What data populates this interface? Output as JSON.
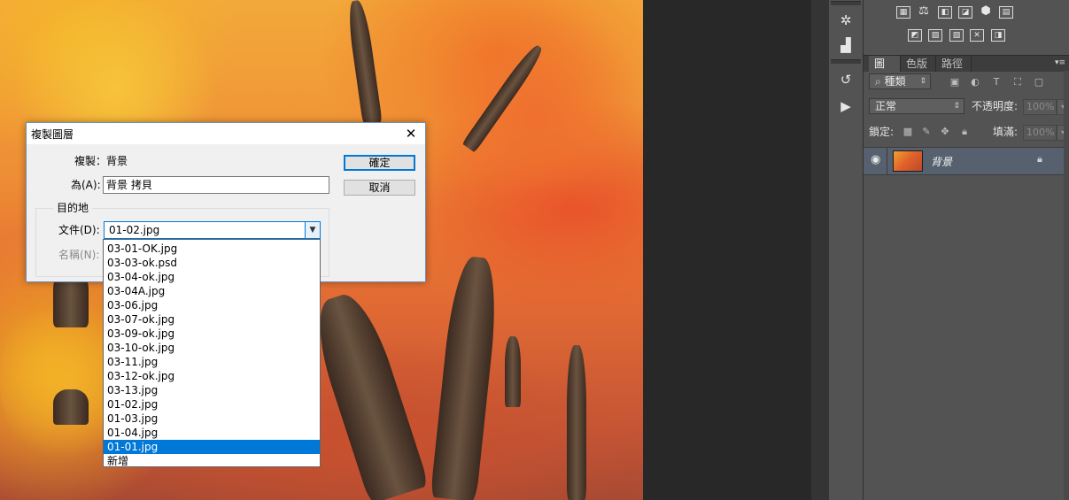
{
  "dialog": {
    "title": "複製圖層",
    "duplicate_label": "複製：",
    "duplicate_value": "背景",
    "as_label": "為(A):",
    "as_value": "背景 拷貝",
    "ok": "確定",
    "cancel": "取消",
    "destination_label": "目的地",
    "document_label": "文件(D):",
    "document_value": "01-02.jpg",
    "name_label": "名稱(N):"
  },
  "dropdown": {
    "items": [
      "03-01-OK.jpg",
      "03-03-ok.psd",
      "03-04-ok.jpg",
      "03-04A.jpg",
      "03-06.jpg",
      "03-07-ok.jpg",
      "03-09-ok.jpg",
      "03-10-ok.jpg",
      "03-11.jpg",
      "03-12-ok.jpg",
      "03-13.jpg",
      "01-02.jpg",
      "01-03.jpg",
      "01-04.jpg",
      "01-01.jpg",
      "新增"
    ],
    "selected": "01-01.jpg"
  },
  "panel": {
    "tabs": [
      "圖層",
      "色版",
      "路徑"
    ],
    "active_tab": "圖層",
    "kind_label": "種類",
    "blend_mode": "正常",
    "opacity_label": "不透明度:",
    "opacity_value": "100%",
    "lock_label": "鎖定:",
    "fill_label": "填滿:",
    "fill_value": "100%",
    "layer_name": "背景"
  },
  "colors": {
    "selection": "#0078d7",
    "panel_bg": "#535353",
    "layer_selected": "#56606e"
  }
}
